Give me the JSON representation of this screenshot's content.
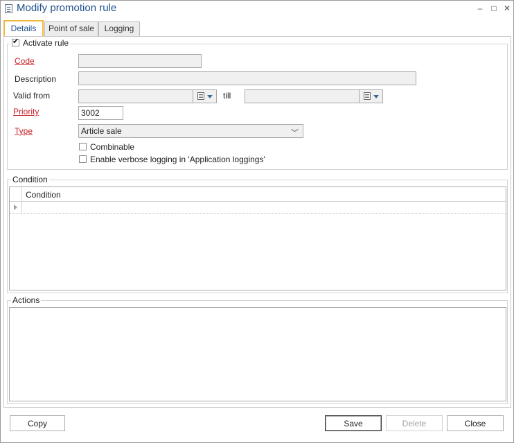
{
  "window": {
    "title": "Modify promotion rule"
  },
  "tabs": [
    {
      "label": "Details",
      "active": true
    },
    {
      "label": "Point of sale",
      "active": false
    },
    {
      "label": "Logging",
      "active": false
    }
  ],
  "details": {
    "activate_rule_label": "Activate rule",
    "activate_rule_checked": true,
    "code_label": "Code",
    "code_value": "",
    "description_label": "Description",
    "description_value": "",
    "valid_from_label": "Valid from",
    "valid_from_value": "",
    "till_label": "till",
    "till_value": "",
    "priority_label": "Priority",
    "priority_value": "3002",
    "type_label": "Type",
    "type_value": "Article sale",
    "combinable_label": "Combinable",
    "combinable_checked": false,
    "verbose_logging_label": "Enable verbose logging in 'Application loggings'",
    "verbose_logging_checked": false
  },
  "condition": {
    "group_label": "Condition",
    "column_header": "Condition",
    "rows": [
      ""
    ]
  },
  "actions": {
    "group_label": "Actions"
  },
  "buttons": {
    "copy": "Copy",
    "save": "Save",
    "delete": "Delete",
    "close": "Close"
  },
  "colors": {
    "title": "#1f4e8c",
    "required_label": "#c8242b",
    "active_tab_border": "#f0b93c"
  }
}
